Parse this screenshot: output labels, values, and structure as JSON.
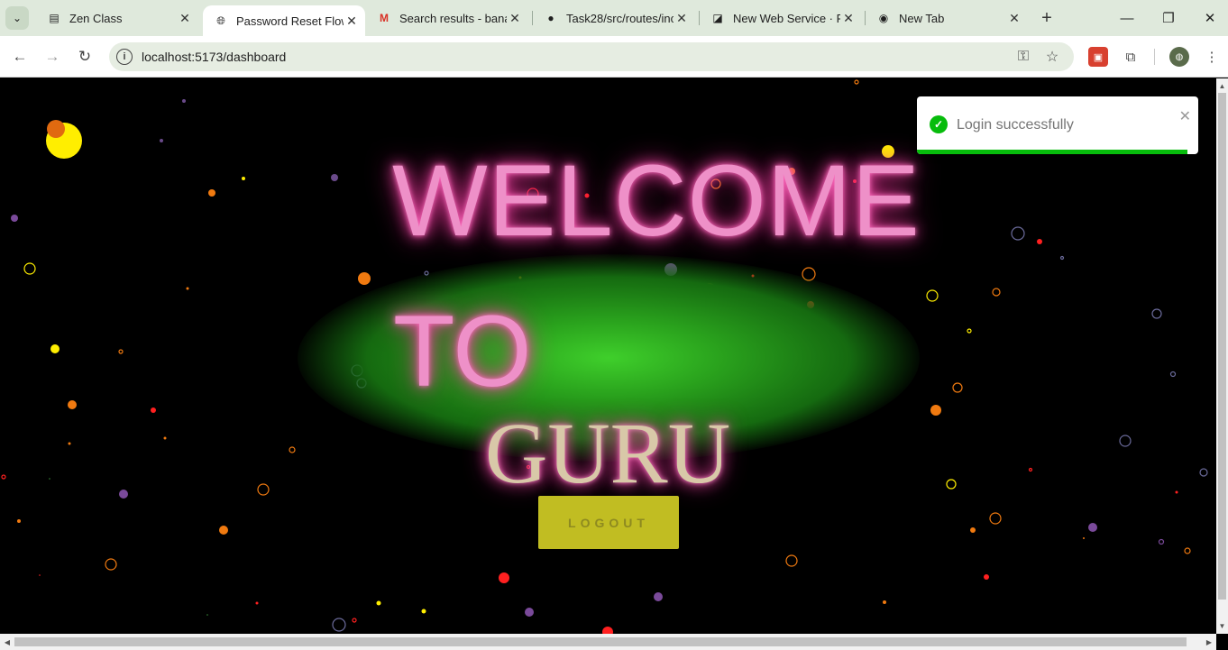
{
  "browser": {
    "tabs": [
      {
        "title": "Zen Class",
        "favicon": "zen-class-icon",
        "active": false
      },
      {
        "title": "Password Reset Flow",
        "favicon": "globe-icon",
        "active": true
      },
      {
        "title": "Search results - bana",
        "favicon": "gmail-icon",
        "active": false
      },
      {
        "title": "Task28/src/routes/inc",
        "favicon": "github-icon",
        "active": false
      },
      {
        "title": "New Web Service · R",
        "favicon": "render-icon",
        "active": false
      },
      {
        "title": "New Tab",
        "favicon": "chrome-icon",
        "active": false
      }
    ],
    "url": "localhost:5173/dashboard"
  },
  "page": {
    "heading_line1": "WELCOME",
    "heading_line2": "TO",
    "heading_line3": "GURU",
    "logout_label": "LOGOUT",
    "colors": {
      "neon_pink": "#ee90c8",
      "glow_green": "#3fcf2b",
      "button_yellow": "#c1bd22"
    }
  },
  "toast": {
    "message": "Login successfully",
    "type": "success",
    "progress": 0.96
  }
}
